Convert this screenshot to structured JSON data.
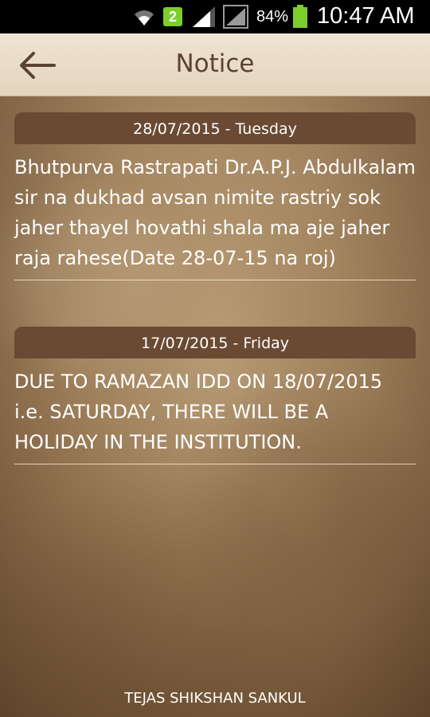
{
  "status_bar": {
    "notification_count": "2",
    "battery_percent": "84%",
    "time": "10:47 AM"
  },
  "header": {
    "title": "Notice"
  },
  "notices": [
    {
      "date": "28/07/2015 - Tuesday",
      "text": "Bhutpurva Rastrapati Dr.A.P.J. Abdulkalam sir na dukhad avsan nimite rastriy sok jaher thayel hovathi shala ma aje jaher raja rahese(Date 28-07-15 na roj)"
    },
    {
      "date": "17/07/2015 - Friday",
      "text": "DUE TO RAMAZAN IDD ON 18/07/2015 i.e. SATURDAY, THERE WILL BE A HOLIDAY IN THE INSTITUTION."
    }
  ],
  "footer": {
    "text": "TEJAS SHIKSHAN SANKUL"
  }
}
